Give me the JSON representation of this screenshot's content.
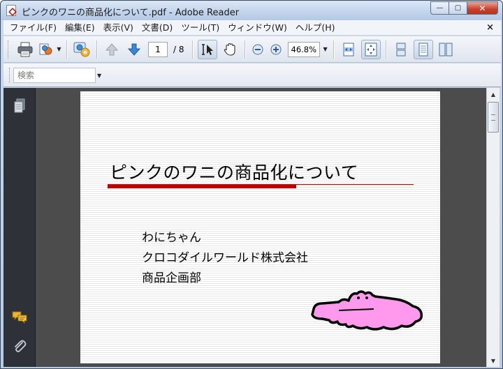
{
  "window": {
    "title": "ピンクのワニの商品化について.pdf - Adobe Reader",
    "minimize_glyph": "—",
    "maximize_glyph": "▢",
    "close_glyph": "✕"
  },
  "menubar": {
    "items": [
      "ファイル(F)",
      "編集(E)",
      "表示(V)",
      "文書(D)",
      "ツール(T)",
      "ウィンドウ(W)",
      "ヘルプ(H)"
    ],
    "close_glyph": "×"
  },
  "toolbar": {
    "page_current": "1",
    "page_total": "/ 8",
    "zoom": "46.8%",
    "icons": [
      "printer-icon",
      "share-icon",
      "collaborate-icon",
      "previous-page-icon",
      "next-page-icon",
      "select-tool-icon",
      "hand-tool-icon",
      "zoom-out-icon",
      "zoom-in-icon",
      "fit-width-icon",
      "fit-page-icon",
      "single-page-icon",
      "continuous-icon",
      "two-page-icon"
    ]
  },
  "search": {
    "placeholder": "検索"
  },
  "document": {
    "slide_title": "ピンクのワニの商品化について",
    "lines": [
      "わにちゃん",
      "クロコダイルワールド株式会社",
      "商品企画部"
    ]
  },
  "colors": {
    "title_rule": "#c00000",
    "croc_fill": "#ff99ee",
    "croc_outline": "#000000",
    "doc_background": "#4c4c4c",
    "nav_panel": "#2e3238"
  }
}
